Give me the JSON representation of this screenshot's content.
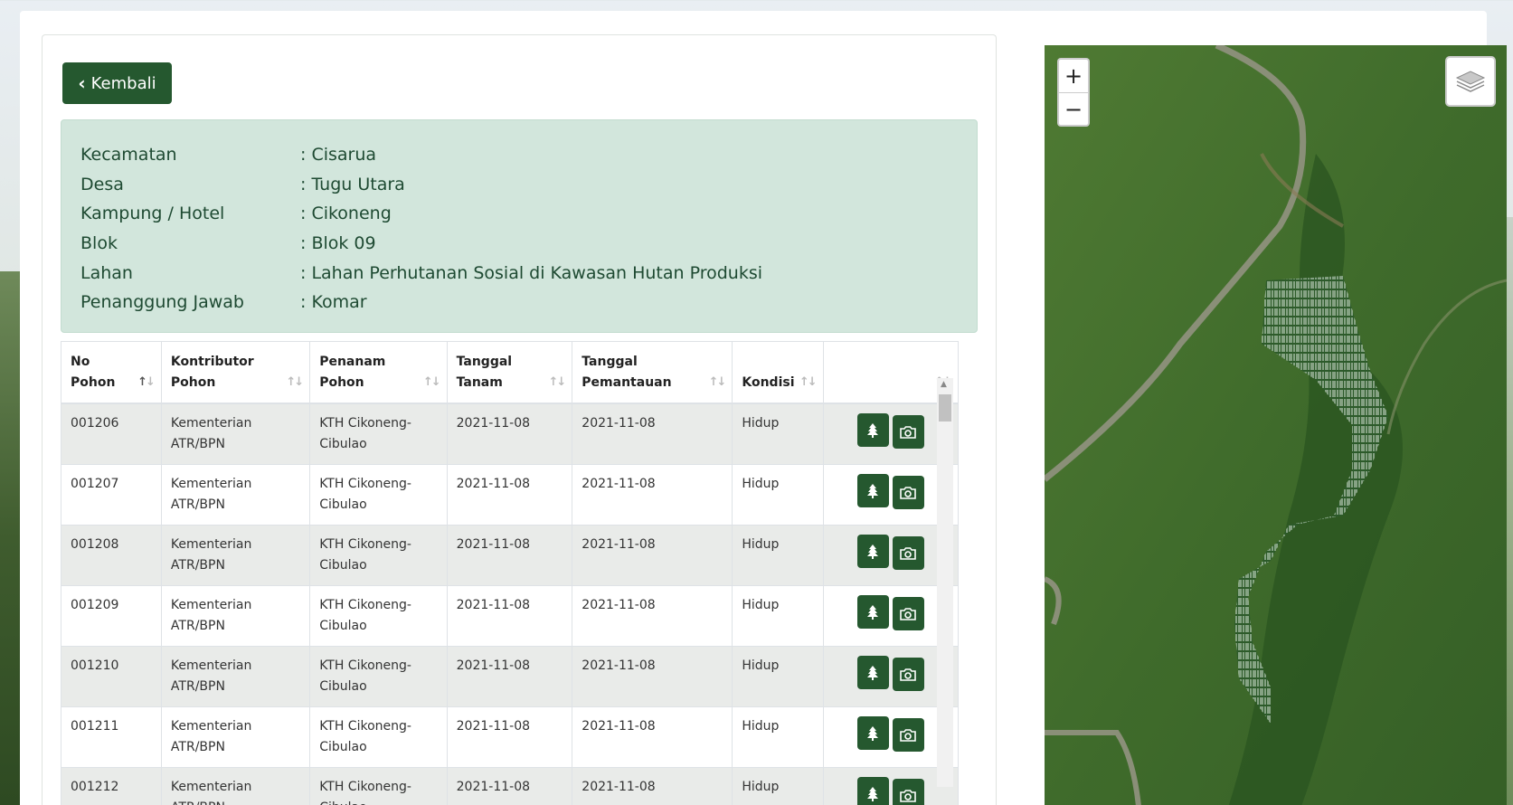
{
  "back_button": {
    "label": "Kembali",
    "icon": "chevron-left-icon"
  },
  "info": [
    {
      "label": "Kecamatan",
      "value": ": Cisarua"
    },
    {
      "label": "Desa",
      "value": ": Tugu Utara"
    },
    {
      "label": "Kampung / Hotel",
      "value": ": Cikoneng"
    },
    {
      "label": "Blok",
      "value": ": Blok 09"
    },
    {
      "label": "Lahan",
      "value": ": Lahan Perhutanan Sosial di Kawasan Hutan Produksi"
    },
    {
      "label": "Penanggung Jawab",
      "value": ": Komar"
    }
  ],
  "table": {
    "headers": [
      {
        "line1": "No",
        "line2": "Pohon"
      },
      {
        "line1": "Kontributor",
        "line2": "Pohon"
      },
      {
        "line1": "Penanam",
        "line2": "Pohon"
      },
      {
        "line1": "Tanggal",
        "line2": "Tanam"
      },
      {
        "line1": "Tanggal",
        "line2": "Pemantauan"
      },
      {
        "line1": "",
        "line2": "Kondisi"
      },
      {
        "line1": "",
        "line2": ""
      }
    ],
    "rows": [
      {
        "no": "001206",
        "kontributor_1": "Kementerian",
        "kontributor_2": "ATR/BPN",
        "penanam_1": "KTH Cikoneng-",
        "penanam_2": "Cibulao",
        "tanam": "2021-11-08",
        "pantau": "2021-11-08",
        "kondisi": "Hidup"
      },
      {
        "no": "001207",
        "kontributor_1": "Kementerian",
        "kontributor_2": "ATR/BPN",
        "penanam_1": "KTH Cikoneng-",
        "penanam_2": "Cibulao",
        "tanam": "2021-11-08",
        "pantau": "2021-11-08",
        "kondisi": "Hidup"
      },
      {
        "no": "001208",
        "kontributor_1": "Kementerian",
        "kontributor_2": "ATR/BPN",
        "penanam_1": "KTH Cikoneng-",
        "penanam_2": "Cibulao",
        "tanam": "2021-11-08",
        "pantau": "2021-11-08",
        "kondisi": "Hidup"
      },
      {
        "no": "001209",
        "kontributor_1": "Kementerian",
        "kontributor_2": "ATR/BPN",
        "penanam_1": "KTH Cikoneng-",
        "penanam_2": "Cibulao",
        "tanam": "2021-11-08",
        "pantau": "2021-11-08",
        "kondisi": "Hidup"
      },
      {
        "no": "001210",
        "kontributor_1": "Kementerian",
        "kontributor_2": "ATR/BPN",
        "penanam_1": "KTH Cikoneng-",
        "penanam_2": "Cibulao",
        "tanam": "2021-11-08",
        "pantau": "2021-11-08",
        "kondisi": "Hidup"
      },
      {
        "no": "001211",
        "kontributor_1": "Kementerian",
        "kontributor_2": "ATR/BPN",
        "penanam_1": "KTH Cikoneng-",
        "penanam_2": "Cibulao",
        "tanam": "2021-11-08",
        "pantau": "2021-11-08",
        "kondisi": "Hidup"
      },
      {
        "no": "001212",
        "kontributor_1": "Kementerian",
        "kontributor_2": "ATR/BPN",
        "penanam_1": "KTH Cikoneng-",
        "penanam_2": "Cibulao",
        "tanam": "2021-11-08",
        "pantau": "2021-11-08",
        "kondisi": "Hidup"
      }
    ],
    "row_actions": [
      "tree-icon",
      "camera-icon"
    ]
  },
  "map": {
    "zoom_in": "+",
    "zoom_out": "−",
    "layers_icon": "layers-icon"
  },
  "colors": {
    "primary": "#25582f",
    "info_bg": "#d2e6dc",
    "info_text": "#1e4a32",
    "row_stripe": "#e9ebe9"
  }
}
